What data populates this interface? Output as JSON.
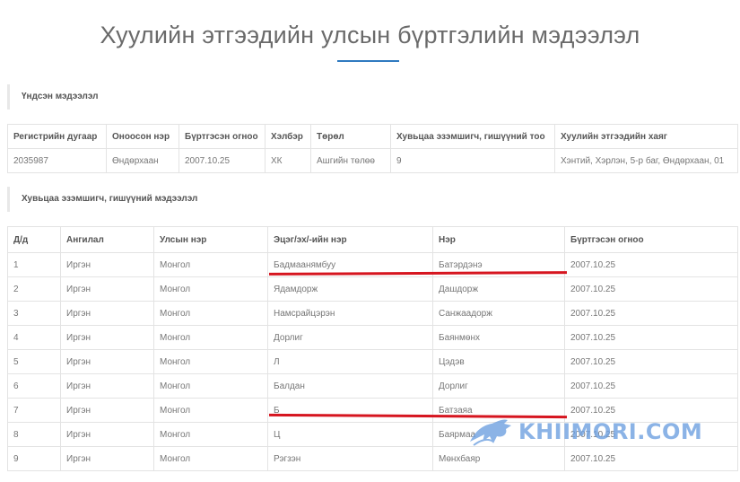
{
  "page": {
    "title": "Хуулийн этгээдийн улсын бүртгэлийн мэдээлэл"
  },
  "basic_section": {
    "heading": "Үндсэн мэдээлэл",
    "columns": [
      "Регистрийн дугаар",
      "Оноосон нэр",
      "Бүртгэсэн огноо",
      "Хэлбэр",
      "Төрөл",
      "Хувьцаа эзэмшигч, гишүүний тоо",
      "Хуулийн этгээдийн хаяг"
    ],
    "row": [
      "2035987",
      "Өндөрхаан",
      "2007.10.25",
      "ХК",
      "Ашгийн төлөө",
      "9",
      "Хэнтий, Хэрлэн, 5-р баг, Өндөрхаан, 01"
    ]
  },
  "holders_section": {
    "heading": "Хувьцаа эзэмшигч, гишүүний мэдээлэл",
    "columns": [
      "Д/д",
      "Ангилал",
      "Улсын нэр",
      "Эцэг/эх/-ийн нэр",
      "Нэр",
      "Бүртгэсэн огноо"
    ],
    "rows": [
      [
        "1",
        "Иргэн",
        "Монгол",
        "Бадмаанямбуу",
        "Батэрдэнэ",
        "2007.10.25"
      ],
      [
        "2",
        "Иргэн",
        "Монгол",
        "Ядамдорж",
        "Дашдорж",
        "2007.10.25"
      ],
      [
        "3",
        "Иргэн",
        "Монгол",
        "Намсрайцэрэн",
        "Санжаадорж",
        "2007.10.25"
      ],
      [
        "4",
        "Иргэн",
        "Монгол",
        "Дорлиг",
        "Баянмөнх",
        "2007.10.25"
      ],
      [
        "5",
        "Иргэн",
        "Монгол",
        "Л",
        "Цэдэв",
        "2007.10.25"
      ],
      [
        "6",
        "Иргэн",
        "Монгол",
        "Балдан",
        "Дорлиг",
        "2007.10.25"
      ],
      [
        "7",
        "Иргэн",
        "Монгол",
        "Б",
        "Батзаяа",
        "2007.10.25"
      ],
      [
        "8",
        "Иргэн",
        "Монгол",
        "Ц",
        "Баярмаа",
        "2007.10.25"
      ],
      [
        "9",
        "Иргэн",
        "Монгол",
        "Рэгзэн",
        "Мөнхбаяр",
        "2007.10.25"
      ]
    ]
  },
  "watermark": {
    "text": "KHIIMORI.COM",
    "color": "#6fa1e0"
  },
  "colors": {
    "accent": "#2f7ac0",
    "annotation": "#d6151f"
  }
}
